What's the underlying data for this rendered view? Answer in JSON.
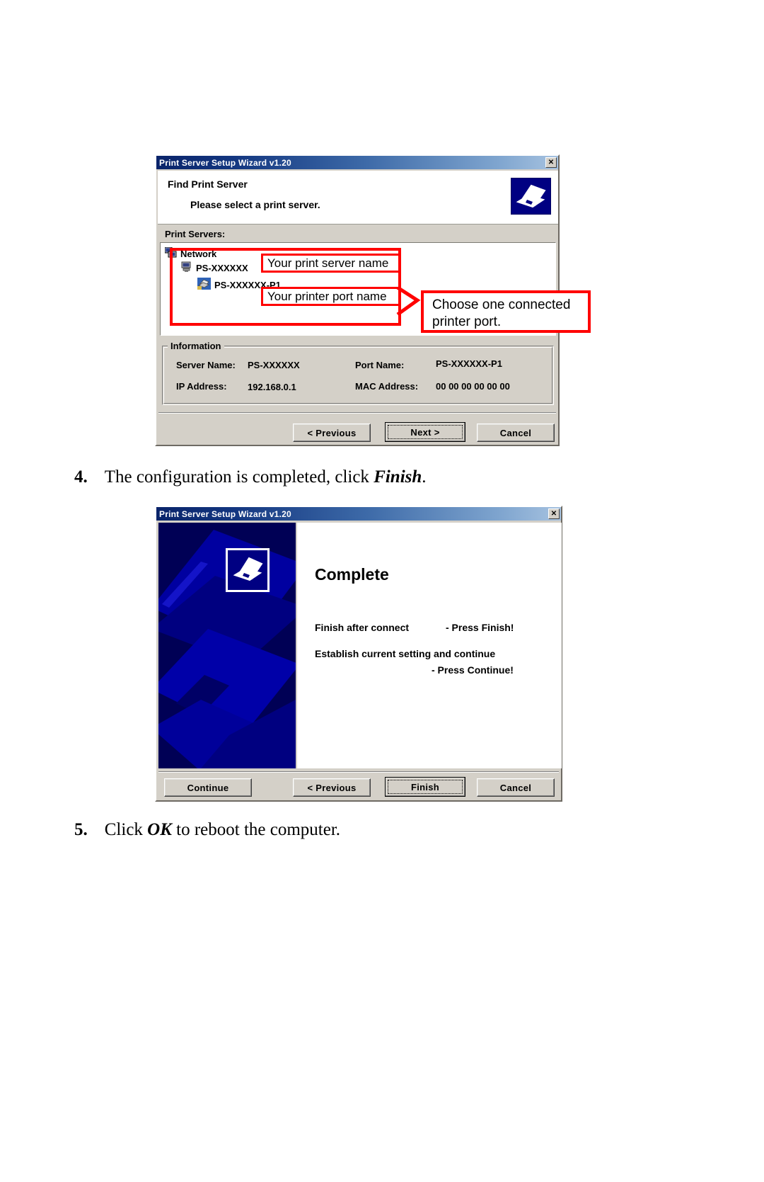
{
  "document": {
    "steps": [
      {
        "number": "4.",
        "text_before": "The configuration is completed, click ",
        "emphasis": "Finish",
        "text_after": "."
      },
      {
        "number": "5.",
        "text_before": "Click ",
        "emphasis": "OK",
        "text_after": " to reboot the computer."
      }
    ]
  },
  "dialog_find": {
    "title": "Print Server Setup Wizard v1.20",
    "close_label": "✕",
    "header": {
      "heading": "Find Print Server",
      "subheading": "Please select a print server.",
      "icon": "printer-icon"
    },
    "list_label": "Print Servers:",
    "tree": [
      {
        "label": "Network",
        "icon": "network-icon",
        "indent": 0
      },
      {
        "label": "PS-XXXXXX",
        "icon": "print-server-icon",
        "indent": 1
      },
      {
        "label": "PS-XXXXXX-P1",
        "icon": "printer-port-icon",
        "indent": 2
      }
    ],
    "information": {
      "legend": "Information",
      "server_name_label": "Server Name:",
      "server_name_value": "PS-XXXXXX",
      "port_name_label": "Port Name:",
      "port_name_value": "PS-XXXXXX-P1",
      "ip_address_label": "IP Address:",
      "ip_address_value": "192.168.0.1",
      "mac_address_label": "MAC Address:",
      "mac_address_value": "00 00 00 00 00 00"
    },
    "buttons": {
      "previous": "< Previous",
      "next": "Next >",
      "cancel": "Cancel"
    },
    "annotations": {
      "server_name_callout": "Your print server name",
      "port_name_callout": "Your printer port name",
      "choose_port_callout_line1": "Choose one connected",
      "choose_port_callout_line2": "printer port.",
      "highlight_color": "#ff0000"
    }
  },
  "dialog_complete": {
    "title": "Print Server Setup Wizard v1.20",
    "close_label": "✕",
    "splash_icon": "printer-icon",
    "heading": "Complete",
    "lines": [
      {
        "left": "Finish after connect",
        "right": "- Press Finish!"
      },
      {
        "left": "Establish current setting and continue",
        "right": "- Press Continue!"
      }
    ],
    "buttons": {
      "continue": "Continue",
      "previous": "< Previous",
      "finish": "Finish",
      "cancel": "Cancel"
    }
  },
  "colors": {
    "title_bar_start": "#0a246a",
    "title_bar_end": "#a6c2e0",
    "dialog_face": "#d4d0c8",
    "splash_blue": "#000080",
    "annotation_red": "#ff0000"
  }
}
